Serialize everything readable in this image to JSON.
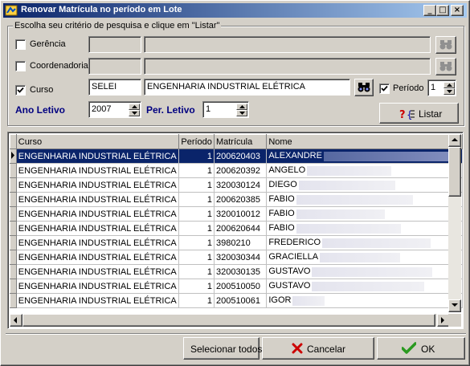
{
  "window": {
    "title": "Renovar Matrícula no período em Lote",
    "minimize_glyph": "_",
    "maximize_glyph": "□",
    "close_glyph": "×"
  },
  "filters": {
    "legend": "Escolha seu critério de pesquisa e clique em \"Listar\"",
    "gerencia": {
      "label": "Gerência",
      "checked": false,
      "code": "",
      "name": ""
    },
    "coordenadoria": {
      "label": "Coordenadoria",
      "checked": false,
      "code": "",
      "name": ""
    },
    "curso": {
      "label": "Curso",
      "checked": true,
      "code": "SELEI",
      "name": "ENGENHARIA INDUSTRIAL ELÉTRICA"
    },
    "periodo": {
      "label": "Período",
      "checked": true,
      "value": "1"
    },
    "ano_letivo": {
      "label": "Ano Letivo",
      "value": "2007"
    },
    "per_letivo": {
      "label": "Per. Letivo",
      "value": "1"
    },
    "listar_label": "Listar"
  },
  "grid": {
    "columns": [
      "Curso",
      "Período",
      "Matrícula",
      "Nome"
    ],
    "rows": [
      {
        "curso": "ENGENHARIA INDUSTRIAL ELÉTRICA",
        "periodo": "1",
        "matricula": "200620403",
        "nome": "ALEXANDRE"
      },
      {
        "curso": "ENGENHARIA INDUSTRIAL ELÉTRICA",
        "periodo": "1",
        "matricula": "200620392",
        "nome": "ANGELO"
      },
      {
        "curso": "ENGENHARIA INDUSTRIAL ELÉTRICA",
        "periodo": "1",
        "matricula": "320030124",
        "nome": "DIEGO"
      },
      {
        "curso": "ENGENHARIA INDUSTRIAL ELÉTRICA",
        "periodo": "1",
        "matricula": "200620385",
        "nome": "FABIO"
      },
      {
        "curso": "ENGENHARIA INDUSTRIAL ELÉTRICA",
        "periodo": "1",
        "matricula": "320010012",
        "nome": "FABIO"
      },
      {
        "curso": "ENGENHARIA INDUSTRIAL ELÉTRICA",
        "periodo": "1",
        "matricula": "200620644",
        "nome": "FABIO"
      },
      {
        "curso": "ENGENHARIA INDUSTRIAL ELÉTRICA",
        "periodo": "1",
        "matricula": "3980210",
        "nome": "FREDERICO"
      },
      {
        "curso": "ENGENHARIA INDUSTRIAL ELÉTRICA",
        "periodo": "1",
        "matricula": "320030344",
        "nome": "GRACIELLA"
      },
      {
        "curso": "ENGENHARIA INDUSTRIAL ELÉTRICA",
        "periodo": "1",
        "matricula": "320030135",
        "nome": "GUSTAVO"
      },
      {
        "curso": "ENGENHARIA INDUSTRIAL ELÉTRICA",
        "periodo": "1",
        "matricula": "200510050",
        "nome": "GUSTAVO"
      },
      {
        "curso": "ENGENHARIA INDUSTRIAL ELÉTRICA",
        "periodo": "1",
        "matricula": "200510061",
        "nome": "IGOR"
      }
    ],
    "selected_row": 0
  },
  "footer": {
    "select_all_label": "Selecionar todos",
    "cancel_label": "Cancelar",
    "ok_label": "OK"
  },
  "colors": {
    "selection": "#0a246a",
    "cancel_icon": "#cc0000",
    "ok_icon": "#2a9a20"
  }
}
